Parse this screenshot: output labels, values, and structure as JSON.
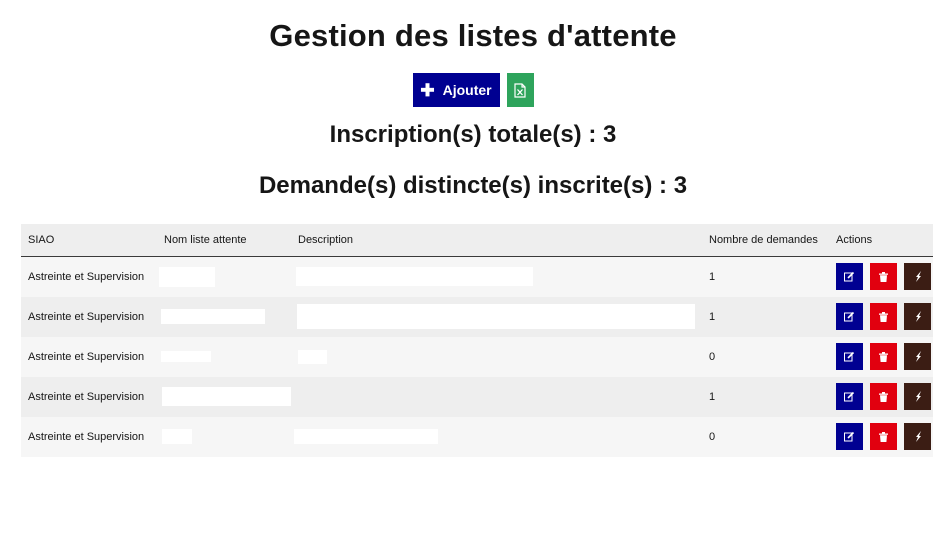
{
  "page": {
    "title": "Gestion des listes d'attente"
  },
  "toolbar": {
    "add_label": "Ajouter",
    "add_icon": "plus-icon",
    "export_icon": "excel-file-icon"
  },
  "stats": {
    "total_label": "Inscription(s) totale(s) : 3",
    "distinct_label": "Demande(s) distincte(s) inscrite(s) : 3"
  },
  "table": {
    "headers": {
      "siao": "SIAO",
      "name": "Nom liste attente",
      "description": "Description",
      "count": "Nombre de demandes",
      "actions": "Actions"
    },
    "rows": [
      {
        "siao": "Astreinte et Supervision",
        "count": "1"
      },
      {
        "siao": "Astreinte et Supervision",
        "count": "1"
      },
      {
        "siao": "Astreinte et Supervision",
        "count": "0"
      },
      {
        "siao": "Astreinte et Supervision",
        "count": "1"
      },
      {
        "siao": "Astreinte et Supervision",
        "count": "0"
      }
    ],
    "action_icons": [
      "edit-icon",
      "trash-icon",
      "manage-icon"
    ]
  },
  "colors": {
    "primary": "#000091",
    "danger": "#e1000f",
    "success": "#2ea45c",
    "dark": "#3b1d14"
  }
}
